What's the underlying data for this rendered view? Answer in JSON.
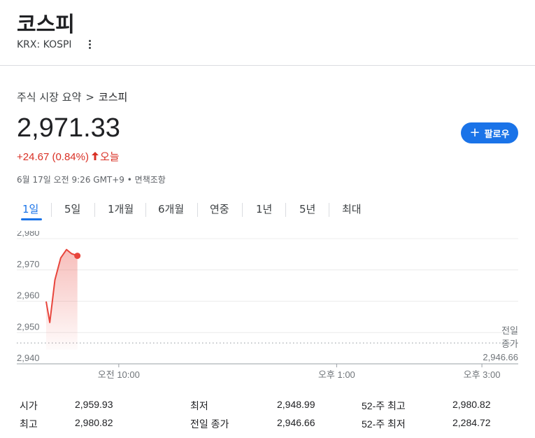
{
  "header": {
    "title": "코스피",
    "exchange": "KRX: KOSPI"
  },
  "breadcrumb": {
    "parent": "주식 시장 요약",
    "separator": ">",
    "current": "코스피"
  },
  "quote": {
    "price": "2,971.33",
    "change": "+24.67 (0.84%)",
    "period": "오늘",
    "timestamp": "6월 17일 오전 9:26 GMT+9 • 면책조항"
  },
  "follow_button": {
    "label": "팔로우"
  },
  "tabs": [
    {
      "label": "1일",
      "active": true
    },
    {
      "label": "5일",
      "active": false
    },
    {
      "label": "1개월",
      "active": false
    },
    {
      "label": "6개월",
      "active": false
    },
    {
      "label": "연중",
      "active": false
    },
    {
      "label": "1년",
      "active": false
    },
    {
      "label": "5년",
      "active": false
    },
    {
      "label": "최대",
      "active": false
    }
  ],
  "colors": {
    "accent": "#1a73e8",
    "negative_up": "#d93025",
    "line": "#e8453c"
  },
  "chart_data": {
    "type": "line",
    "y_ticks": [
      "2,980",
      "2,970",
      "2,960",
      "2,950",
      "2,940"
    ],
    "y_values": [
      2980,
      2970,
      2960,
      2950,
      2940
    ],
    "ylim": [
      2940,
      2980
    ],
    "x_ticks": [
      "오전 10:00",
      "오후 1:00",
      "오후 3:00"
    ],
    "x_tick_hours": [
      10,
      13,
      15
    ],
    "xlim_hours": [
      9,
      15.5
    ],
    "series": [
      {
        "x_hours": [
          9.0,
          9.05,
          9.12,
          9.2,
          9.28,
          9.35,
          9.43
        ],
        "values": [
          2959.9,
          2953.2,
          2966.8,
          2973.8,
          2976.5,
          2975.2,
          2974.5
        ]
      }
    ],
    "reference": {
      "label_line1": "전일",
      "label_line2": "종가",
      "value_label": "2,946.66",
      "value": 2946.66
    },
    "grid": true
  },
  "stats": [
    {
      "label": "시가",
      "value": "2,959.93"
    },
    {
      "label": "최고",
      "value": "2,980.82"
    },
    {
      "label": "최저",
      "value": "2,948.99"
    },
    {
      "label": "전일 종가",
      "value": "2,946.66"
    },
    {
      "label": "52-주 최고",
      "value": "2,980.82"
    },
    {
      "label": "52-주 최저",
      "value": "2,284.72"
    }
  ]
}
